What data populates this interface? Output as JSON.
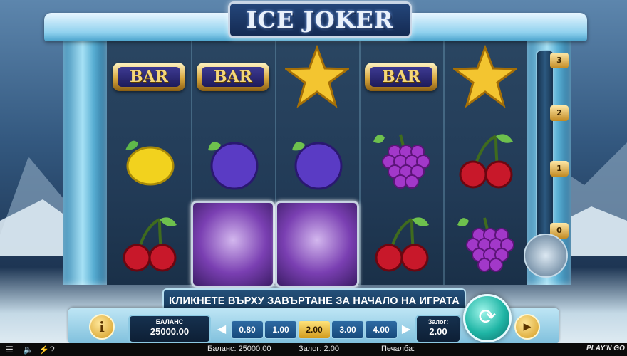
{
  "game": {
    "title": "ICE JOKER"
  },
  "reels": [
    [
      "bar",
      "lemon",
      "cherry"
    ],
    [
      "bar",
      "plum",
      "joker"
    ],
    [
      "star",
      "plum",
      "joker"
    ],
    [
      "bar",
      "grapes",
      "cherry"
    ],
    [
      "star",
      "cherry",
      "grapes"
    ]
  ],
  "symbols": {
    "bar_text": "BAR"
  },
  "multiplier_meter": {
    "levels": [
      "3",
      "2",
      "1",
      "0"
    ]
  },
  "message": "КЛИКНЕТЕ ВЪРХУ ЗАВЪРТАНЕ ЗА НАЧАЛО НА ИГРАТА",
  "controls": {
    "info_label": "i",
    "balance_label": "БАЛАНС",
    "balance_value": "25000.00",
    "bet_options": [
      "0.80",
      "1.00",
      "2.00",
      "3.00",
      "4.00"
    ],
    "selected_bet": "2.00",
    "bet_label": "Залог:",
    "bet_value": "2.00",
    "spin_icon": "refresh-icon",
    "autoplay_icon": "play-icon"
  },
  "status_bar": {
    "balance": "Баланс: 25000.00",
    "bet": "Залог: 2.00",
    "win": "Печалба:",
    "brand": "PLAY'N GO"
  },
  "colors": {
    "selected_bet": "#f2c13c",
    "spin_button": "#1fb5a5"
  }
}
